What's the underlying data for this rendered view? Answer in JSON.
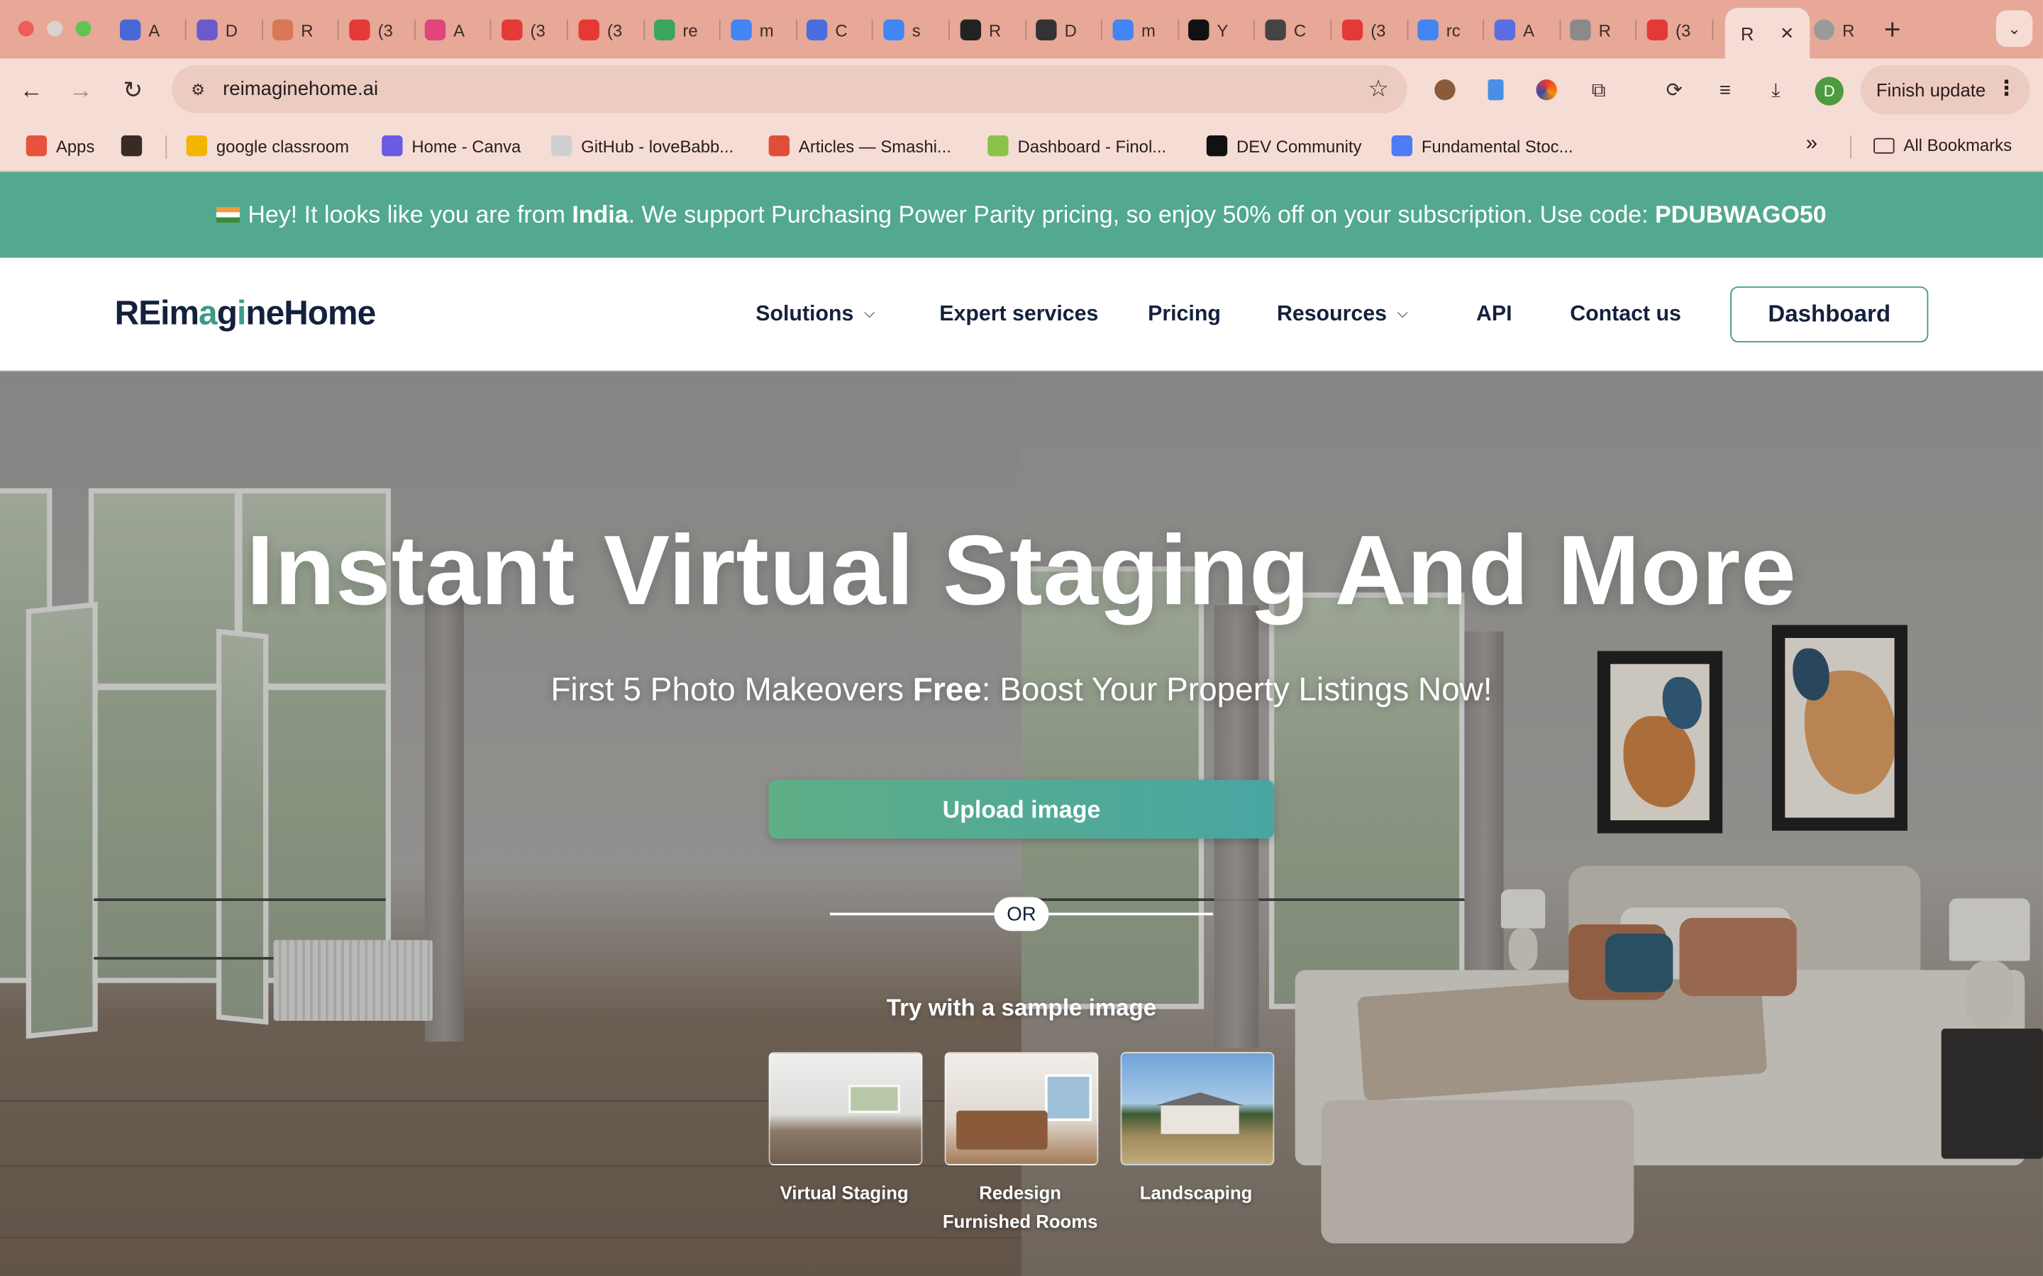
{
  "browser": {
    "tabs": [
      {
        "icon": "openai-icon",
        "title": "A",
        "color": "#4a67d6"
      },
      {
        "icon": "dora-icon",
        "title": "D",
        "color": "#6a5acd"
      },
      {
        "icon": "claude-icon",
        "title": "R",
        "color": "#d97757"
      },
      {
        "icon": "youtube-icon",
        "title": "(3",
        "color": "#e53935"
      },
      {
        "icon": "app-icon",
        "title": "A",
        "color": "#e0457b"
      },
      {
        "icon": "youtube-icon",
        "title": "(3",
        "color": "#e53935"
      },
      {
        "icon": "youtube-icon",
        "title": "(3",
        "color": "#e53935"
      },
      {
        "icon": "hash-icon",
        "title": "re",
        "color": "#3ba55c"
      },
      {
        "icon": "google-icon",
        "title": "m",
        "color": "#4285f4"
      },
      {
        "icon": "docs-icon",
        "title": "C",
        "color": "#4a6ee0"
      },
      {
        "icon": "google-icon",
        "title": "s",
        "color": "#4285f4"
      },
      {
        "icon": "github-icon",
        "title": "R",
        "color": "#222222"
      },
      {
        "icon": "app-icon",
        "title": "D",
        "color": "#333333"
      },
      {
        "icon": "google-icon",
        "title": "m",
        "color": "#4285f4"
      },
      {
        "icon": "app-icon",
        "title": "Y",
        "color": "#111111"
      },
      {
        "icon": "openai-icon",
        "title": "C",
        "color": "#444444"
      },
      {
        "icon": "youtube-icon",
        "title": "(3",
        "color": "#e53935"
      },
      {
        "icon": "google-icon",
        "title": "rc",
        "color": "#4285f4"
      },
      {
        "icon": "app-icon",
        "title": "A",
        "color": "#5b6ee1"
      },
      {
        "icon": "globe-icon",
        "title": "R",
        "color": "#8a8a8a"
      },
      {
        "icon": "youtube-icon",
        "title": "(3",
        "color": "#e53935"
      }
    ],
    "active_tab": {
      "title": "R",
      "close": "✕"
    },
    "after_tab": {
      "icon": "globe-icon",
      "title": "R"
    },
    "new_tab": "+",
    "url": "reimaginehome.ai",
    "profile_initial": "D",
    "finish_update": "Finish update",
    "bookmarks": [
      {
        "icon": "apps-grid-icon",
        "label": "Apps",
        "color": "#e5533d"
      },
      {
        "icon": "grid-icon",
        "label": "",
        "color": "#3a2a26"
      },
      {
        "icon": "classroom-icon",
        "label": "google classroom",
        "color": "#f4b400"
      },
      {
        "icon": "canva-icon",
        "label": "Home - Canva",
        "color": "#6a5be2"
      },
      {
        "icon": "github-icon",
        "label": "GitHub - loveBabb...",
        "color": "#cfcfcf"
      },
      {
        "icon": "smashing-icon",
        "label": "Articles — Smashi...",
        "color": "#e04e39"
      },
      {
        "icon": "finology-icon",
        "label": "Dashboard - Finol...",
        "color": "#8bc34a"
      },
      {
        "icon": "dev-icon",
        "label": "DEV Community",
        "color": "#111111"
      },
      {
        "icon": "stocks-icon",
        "label": "Fundamental Stoc...",
        "color": "#4d7cf4"
      }
    ],
    "bookmarks_overflow": "»",
    "all_bookmarks": "All Bookmarks"
  },
  "promo": {
    "prefix": "Hey! It looks like you are from ",
    "country": "India",
    "middle": ". We support Purchasing Power Parity pricing, so enjoy 50% off on your subscription. Use code: ",
    "code": "PDUBWAGO50"
  },
  "header": {
    "logo": {
      "part1": "REim",
      "accent1": "a",
      "part2": "g",
      "accent2": "i",
      "part3": "neHome"
    },
    "nav": [
      {
        "label": "Solutions",
        "dropdown": true
      },
      {
        "label": "Expert services",
        "dropdown": false
      },
      {
        "label": "Pricing",
        "dropdown": false
      },
      {
        "label": "Resources",
        "dropdown": true
      },
      {
        "label": "API",
        "dropdown": false
      },
      {
        "label": "Contact us",
        "dropdown": false
      }
    ],
    "dashboard_button": "Dashboard"
  },
  "hero": {
    "title": "Instant Virtual Staging And More",
    "subtitle_pre": "First 5 Photo Makeovers ",
    "subtitle_bold": "Free",
    "subtitle_post": ": Boost Your Property Listings Now!",
    "upload_button": "Upload image",
    "or": "OR",
    "sample_label": "Try with a sample image",
    "samples": [
      {
        "caption": "Virtual Staging"
      },
      {
        "caption": "Redesign\nFurnished Rooms"
      },
      {
        "caption": "Landscaping"
      }
    ]
  },
  "colors": {
    "accent": "#3c9b86",
    "promo_bg": "#52a98f",
    "navy": "#14213d",
    "chrome_tabstrip": "#e7a898",
    "chrome_toolbar": "#f5ddd5"
  }
}
